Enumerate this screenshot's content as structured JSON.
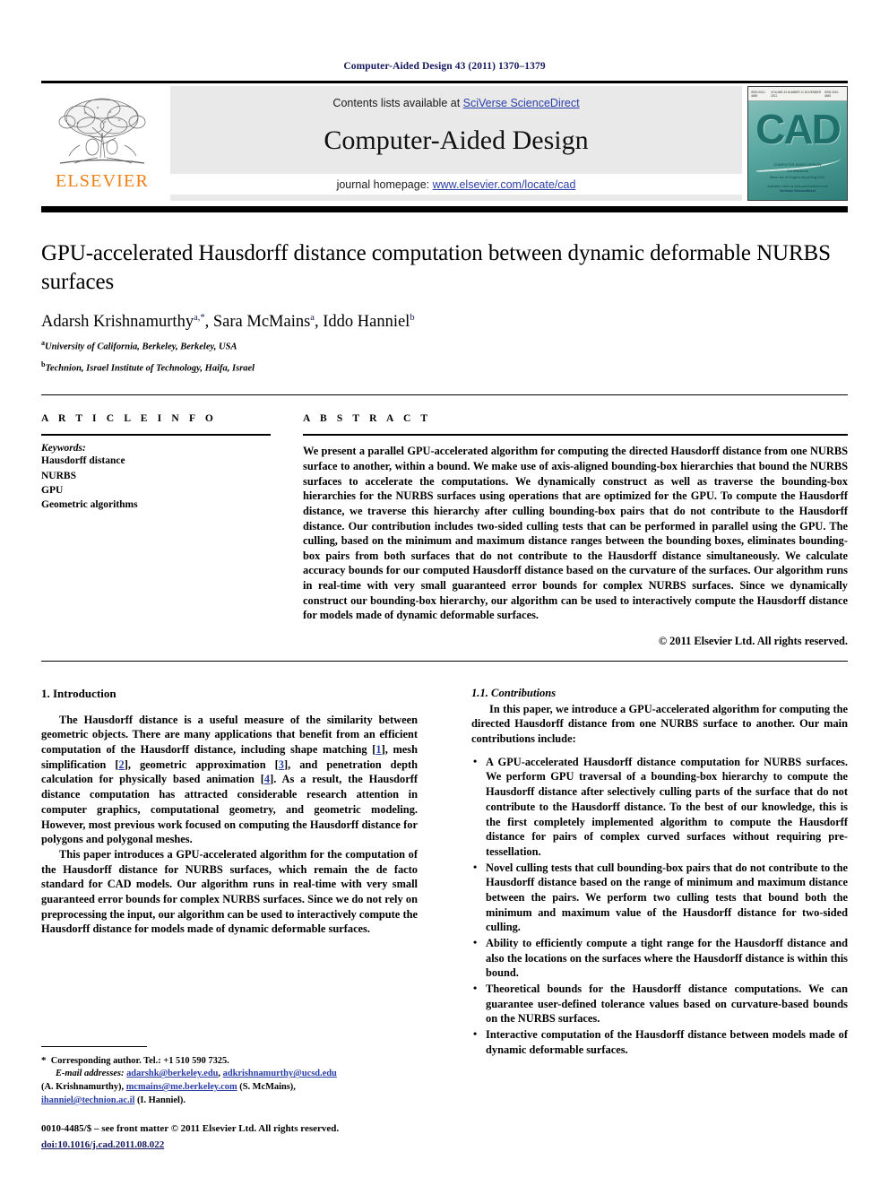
{
  "running_head": "Computer-Aided Design 43 (2011) 1370–1379",
  "masthead": {
    "contents_prefix": "Contents lists available at ",
    "sciencedirect_link": "SciVerse ScienceDirect",
    "journal_title": "Computer-Aided Design",
    "homepage_prefix": "journal homepage: ",
    "homepage_link": "www.elsevier.com/locate/cad",
    "publisher_wordmark": "ELSEVIER",
    "publisher_color": "#f07f13",
    "link_color": "#2b3ea8",
    "cover": {
      "title_letters": "CAD",
      "top_left": "ISSN 0010-4485",
      "top_center": "VOLUME 43 NUMBER 11 NOVEMBER 2011",
      "top_right": "ISSN 0010-4485",
      "sub_line_1": "COMPUTER-AIDED DESIGN",
      "sub_line_2": "Contributions",
      "sub_line_3": "Best use of Engine Modelling 2011",
      "foot_line_1": "Available online at www.sciencedirect.com",
      "foot_line_2": "SciVerse ScienceDirect"
    }
  },
  "article": {
    "title": "GPU-accelerated Hausdorff distance computation between dynamic deformable NURBS surfaces",
    "authors": [
      {
        "name": "Adarsh Krishnamurthy",
        "marks": "a,",
        "star": "*",
        "sep": ", "
      },
      {
        "name": "Sara McMains",
        "marks": "a",
        "star": "",
        "sep": ", "
      },
      {
        "name": "Iddo Hanniel",
        "marks": "b",
        "star": "",
        "sep": ""
      }
    ],
    "affiliations": [
      {
        "mark": "a",
        "text": "University of California, Berkeley, Berkeley, USA"
      },
      {
        "mark": "b",
        "text": "Technion, Israel Institute of Technology, Haifa, Israel"
      }
    ]
  },
  "info": {
    "heading": "A R T I C L E   I N F O",
    "keywords_label": "Keywords:",
    "keywords": [
      "Hausdorff distance",
      "NURBS",
      "GPU",
      "Geometric algorithms"
    ]
  },
  "abstract": {
    "heading": "A B S T R A C T",
    "text": "We present a parallel GPU-accelerated algorithm for computing the directed Hausdorff distance from one NURBS surface to another, within a bound. We make use of axis-aligned bounding-box hierarchies that bound the NURBS surfaces to accelerate the computations. We dynamically construct as well as traverse the bounding-box hierarchies for the NURBS surfaces using operations that are optimized for the GPU. To compute the Hausdorff distance, we traverse this hierarchy after culling bounding-box pairs that do not contribute to the Hausdorff distance. Our contribution includes two-sided culling tests that can be performed in parallel using the GPU. The culling, based on the minimum and maximum distance ranges between the bounding boxes, eliminates bounding-box pairs from both surfaces that do not contribute to the Hausdorff distance simultaneously. We calculate accuracy bounds for our computed Hausdorff distance based on the curvature of the surfaces. Our algorithm runs in real-time with very small guaranteed error bounds for complex NURBS surfaces. Since we dynamically construct our bounding-box hierarchy, our algorithm can be used to interactively compute the Hausdorff distance for models made of dynamic deformable surfaces.",
    "copyright": "© 2011 Elsevier Ltd. All rights reserved."
  },
  "body": {
    "intro_heading": "1. Introduction",
    "intro_p1_a": "The Hausdorff distance is a useful measure of the similarity between geometric objects. There are many applications that benefit from an efficient computation of the Hausdorff distance, including shape matching [",
    "cite1": "1",
    "intro_p1_b": "], mesh simplification [",
    "cite2": "2",
    "intro_p1_c": "], geometric approximation [",
    "cite3": "3",
    "intro_p1_d": "], and penetration depth calculation for physically based animation [",
    "cite4": "4",
    "intro_p1_e": "]. As a result, the Hausdorff distance computation has attracted considerable research attention in computer graphics, computational geometry, and geometric modeling. However, most previous work focused on computing the Hausdorff distance for polygons and polygonal meshes.",
    "intro_p2": "This paper introduces a GPU-accelerated algorithm for the computation of the Hausdorff distance for NURBS surfaces, which remain the de facto standard for CAD models. Our algorithm runs in real-time with very small guaranteed error bounds for complex NURBS surfaces. Since we do not rely on preprocessing the input, our algorithm can be used to interactively compute the Hausdorff distance for models made of dynamic deformable surfaces.",
    "contrib_heading": "1.1. Contributions",
    "contrib_intro": "In this paper, we introduce a GPU-accelerated algorithm for computing the directed Hausdorff distance from one NURBS surface to another. Our main contributions include:",
    "contributions": [
      "A GPU-accelerated Hausdorff distance computation for NURBS surfaces. We perform GPU traversal of a bounding-box hierarchy to compute the Hausdorff distance after selectively culling parts of the surface that do not contribute to the Hausdorff distance. To the best of our knowledge, this is the first completely implemented algorithm to compute the Hausdorff distance for pairs of complex curved surfaces without requiring pre-tessellation.",
      "Novel culling tests that cull bounding-box pairs that do not contribute to the Hausdorff distance based on the range of minimum and maximum distance between the pairs. We perform two culling tests that bound both the minimum and maximum value of the Hausdorff distance for two-sided culling.",
      "Ability to efficiently compute a tight range for the Hausdorff distance and also the locations on the surfaces where the Hausdorff distance is within this bound.",
      "Theoretical bounds for the Hausdorff distance computations. We can guarantee user-defined tolerance values based on curvature-based bounds on the NURBS surfaces.",
      "Interactive computation of the Hausdorff distance between models made of dynamic deformable surfaces."
    ]
  },
  "footnotes": {
    "star": "*",
    "corresponding": "Corresponding author. Tel.: +1 510 590 7325.",
    "email_label": "E-mail addresses:",
    "email_1": "adarshk@berkeley.edu",
    "email_2": "adkrishnamurthy@ucsd.edu",
    "email_1_attrib": "(A. Krishnamurthy),",
    "email_3": "mcmains@me.berkeley.com",
    "email_3_attrib": "(S. McMains),",
    "email_4": "ihanniel@technion.ac.il",
    "email_4_attrib": "(I. Hanniel).",
    "issn_line": "0010-4485/$ – see front matter © 2011 Elsevier Ltd. All rights reserved.",
    "doi": "doi:10.1016/j.cad.2011.08.022"
  }
}
